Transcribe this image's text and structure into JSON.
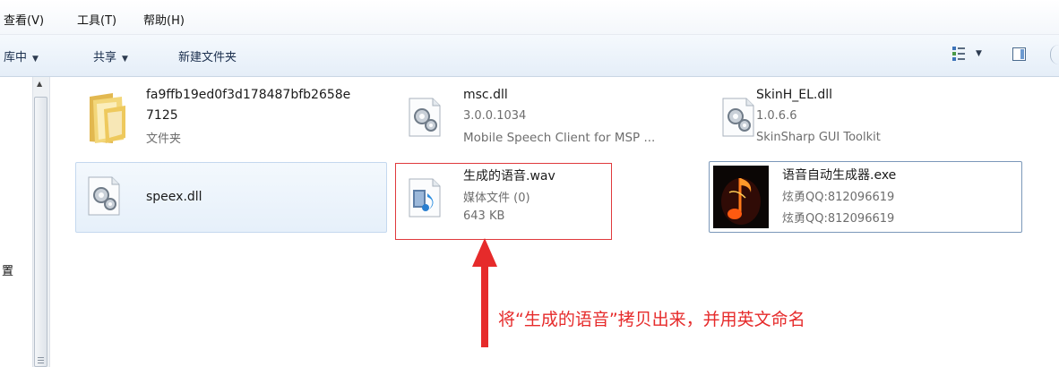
{
  "menu": {
    "view": "查看(V)",
    "tools": "工具(T)",
    "help": "帮助(H)"
  },
  "toolbar": {
    "include_library": "库中",
    "share": "共享",
    "new_folder": "新建文件夹"
  },
  "nav": {
    "partial_label": "置"
  },
  "files": [
    {
      "name_line1": "fa9ffb19ed0f3d178487bfb2658e",
      "name_line2": "7125",
      "type": "文件夹",
      "icon": "folder-icon"
    },
    {
      "name": "msc.dll",
      "version": "3.0.0.1034",
      "description": "Mobile Speech Client for MSP ...",
      "icon": "dll-gear-icon"
    },
    {
      "name": "SkinH_EL.dll",
      "version": "1.0.6.6",
      "description": "SkinSharp GUI Toolkit",
      "icon": "dll-gear-icon"
    },
    {
      "name": "speex.dll",
      "icon": "dll-gear-icon"
    },
    {
      "name": "生成的语音.wav",
      "type": "媒体文件 (0)",
      "size": "643 KB",
      "icon": "audio-file-icon"
    },
    {
      "name": "语音自动生成器.exe",
      "line2": "炫勇QQ:812096619",
      "line3": "炫勇QQ:812096619",
      "icon": "music-note-app-icon"
    }
  ],
  "annotation": {
    "text": "将“生成的语音”拷贝出来，并用英文命名"
  },
  "colors": {
    "annotation_red": "#e62b2b",
    "selection_border": "#c4d8ef"
  }
}
